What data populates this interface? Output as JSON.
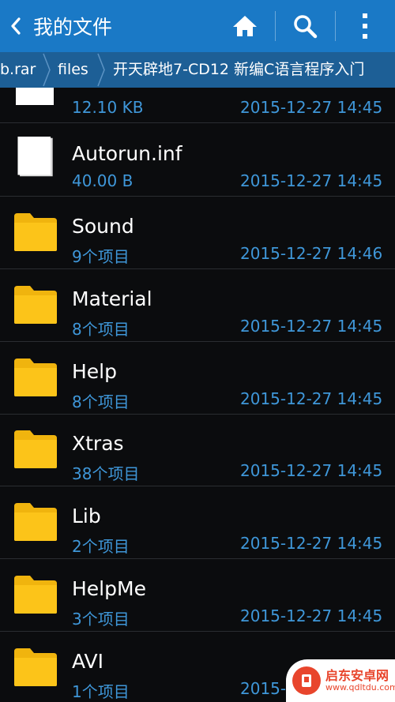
{
  "header": {
    "title": "我的文件",
    "icons": [
      "back-chevron-icon",
      "home-icon",
      "search-icon",
      "overflow-menu-icon"
    ]
  },
  "breadcrumb": {
    "items": [
      "b.rar",
      "files",
      "开天辟地7-CD12 新编C语言程序入门"
    ]
  },
  "files": [
    {
      "type": "file",
      "name": "",
      "meta": "12.10 KB",
      "date": "2015-12-27 14:45"
    },
    {
      "type": "file",
      "name": "Autorun.inf",
      "meta": "40.00 B",
      "date": "2015-12-27 14:45"
    },
    {
      "type": "folder",
      "name": "Sound",
      "meta": "9个项目",
      "date": "2015-12-27 14:46"
    },
    {
      "type": "folder",
      "name": "Material",
      "meta": "8个项目",
      "date": "2015-12-27 14:45"
    },
    {
      "type": "folder",
      "name": "Help",
      "meta": "8个项目",
      "date": "2015-12-27 14:45"
    },
    {
      "type": "folder",
      "name": "Xtras",
      "meta": "38个项目",
      "date": "2015-12-27 14:45"
    },
    {
      "type": "folder",
      "name": "Lib",
      "meta": "2个项目",
      "date": "2015-12-27 14:45"
    },
    {
      "type": "folder",
      "name": "HelpMe",
      "meta": "3个项目",
      "date": "2015-12-27 14:45"
    },
    {
      "type": "folder",
      "name": "AVI",
      "meta": "1个项目",
      "date": "2015-"
    }
  ],
  "watermark": {
    "line1": "启东安卓网",
    "line2": "www.qdltdu.com"
  },
  "colors": {
    "actionbar": "#1a79c6",
    "breadcrumb": "#1d5f96",
    "accent_text": "#3f97d9",
    "folder": "#fcc419",
    "background": "#0b0c0e"
  }
}
